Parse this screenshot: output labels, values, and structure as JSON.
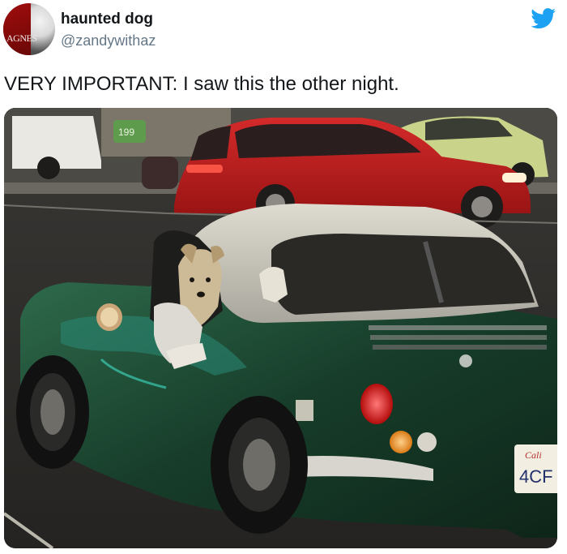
{
  "tweet": {
    "display_name": "haunted dog",
    "handle": "@zandywithaz",
    "text": "VERY IMPORTANT: I saw this the other night.",
    "avatar_text": "AGNES",
    "logo_icon": "twitter-bird-icon",
    "plate_text_top": "Cali",
    "plate_text_main": "4CF",
    "building_sign": "199"
  },
  "colors": {
    "brand": "#1da1f2",
    "name": "#14171a",
    "handle": "#657786"
  }
}
